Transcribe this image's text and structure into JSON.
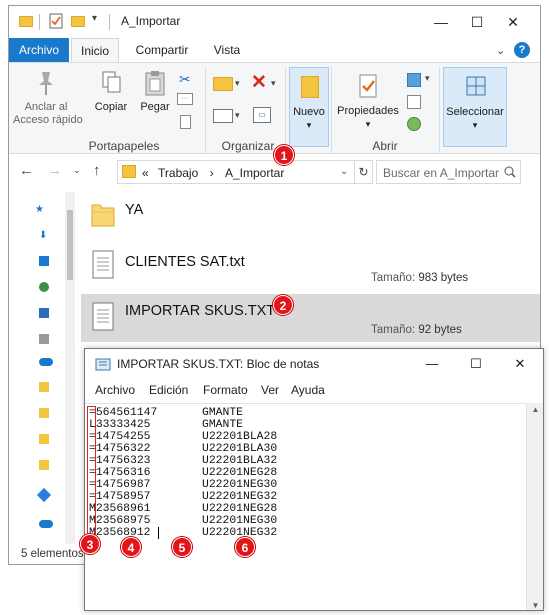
{
  "explorer": {
    "title": "A_Importar",
    "tabs": {
      "file": "Archivo",
      "home": "Inicio",
      "share": "Compartir",
      "view": "Vista"
    },
    "help_glyph": "?",
    "ribbon": {
      "pin": "Anclar al\nAcceso rápido",
      "copy": "Copiar",
      "paste": "Pegar",
      "new": "Nuevo",
      "properties": "Propiedades",
      "select": "Seleccionar",
      "groups": {
        "clipboard": "Portapapeles",
        "organize": "Organizar",
        "open": "Abrir"
      }
    },
    "address": {
      "prefix": "«",
      "crumb1": "Trabajo",
      "sep": "›",
      "crumb2": "A_Importar"
    },
    "search_placeholder": "Buscar en A_Importar",
    "files": [
      {
        "name": "YA",
        "type": "folder",
        "size_label": "",
        "size": ""
      },
      {
        "name": "CLIENTES SAT.txt",
        "type": "text",
        "size_label": "Tamaño:",
        "size": "983 bytes"
      },
      {
        "name": "IMPORTAR SKUS.TXT",
        "type": "text",
        "size_label": "Tamaño:",
        "size": "92 bytes",
        "selected": true
      }
    ],
    "status": "5 elementos"
  },
  "notepad": {
    "title": "IMPORTAR SKUS.TXT: Bloc de notas",
    "menu": {
      "file": "Archivo",
      "edit": "Edición",
      "format": "Formato",
      "view": "Ver",
      "help": "Ayuda"
    },
    "lines": [
      {
        "c1": "=564561147",
        "c2": "GMANTE"
      },
      {
        "c1": "L33333425",
        "c2": "GMANTE"
      },
      {
        "c1": "=14754255",
        "c2": "U22201BLA28"
      },
      {
        "c1": "=14756322",
        "c2": "U22201BLA30"
      },
      {
        "c1": "=14756323",
        "c2": "U22201BLA32"
      },
      {
        "c1": "=14756316",
        "c2": "U22201NEG28"
      },
      {
        "c1": "=14756987",
        "c2": "U22201NEG30"
      },
      {
        "c1": "=14758957",
        "c2": "U22201NEG32"
      },
      {
        "c1": "M23568961",
        "c2": "U22201NEG28"
      },
      {
        "c1": "M23568975",
        "c2": "U22201NEG30"
      },
      {
        "c1": "M23568912",
        "c2": "U22201NEG32"
      }
    ]
  },
  "annotations": {
    "b1": "1",
    "b2": "2",
    "b3": "3",
    "b4": "4",
    "b5": "5",
    "b6": "6"
  },
  "colors": {
    "accent": "#1979ca",
    "folder": "#f5c542",
    "badge": "#e3151b",
    "selection": "#d9d9d9"
  }
}
